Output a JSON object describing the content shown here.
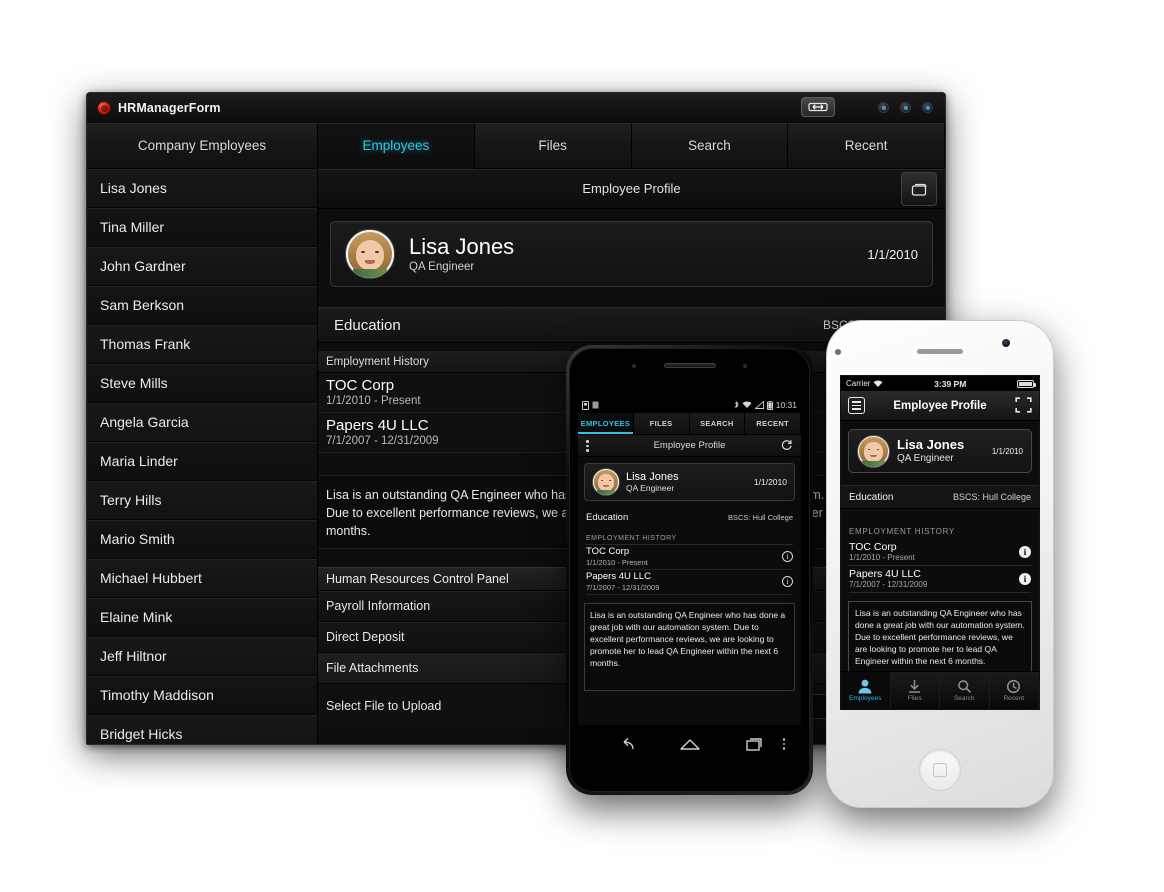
{
  "desktop": {
    "window_title": "HRManagerForm",
    "titlebar": {
      "resize_icon": "resize-arrows-icon",
      "dots": [
        "window-dot-1",
        "window-dot-2",
        "window-dot-3"
      ]
    },
    "tabs": [
      {
        "label": "Company Employees",
        "active": false
      },
      {
        "label": "Employees",
        "active": true
      },
      {
        "label": "Files",
        "active": false
      },
      {
        "label": "Search",
        "active": false
      },
      {
        "label": "Recent",
        "active": false
      }
    ],
    "employees": [
      "Lisa Jones",
      "Tina Miller",
      "John Gardner",
      "Sam Berkson",
      "Thomas Frank",
      "Steve Mills",
      "Angela Garcia",
      "Maria Linder",
      "Terry Hills",
      "Mario Smith",
      "Michael Hubbert",
      "Elaine Mink",
      "Jeff Hiltnor",
      "Timothy Maddison",
      "Bridget Hicks"
    ],
    "main": {
      "header_title": "Employee Profile",
      "expand_icon": "expand-icon",
      "profile": {
        "name": "Lisa Jones",
        "role": "QA Engineer",
        "date": "1/1/2010"
      },
      "education": {
        "label": "Education",
        "value": "BSCS: Hull College"
      },
      "employment_history_label": "Employment History",
      "jobs": [
        {
          "company": "TOC Corp",
          "dates": "1/1/2010 - Present"
        },
        {
          "company": "Papers 4U LLC",
          "dates": "7/1/2007 - 12/31/2009"
        }
      ],
      "notes_line1": "Lisa is an outstanding QA Engineer who has done a great job with our automation system.",
      "notes_line2": "Due to excellent performance reviews, we are looking to promote her to lead QA Engineer within the next 6 months.",
      "hr_panel_title": "Human Resources Control Panel",
      "hr_rows": [
        "Payroll Information",
        "Direct Deposit"
      ],
      "file_attachments_label": "File Attachments",
      "upload_label": "Select File to Upload",
      "upload_value": ""
    }
  },
  "android": {
    "status": {
      "time": "10:31",
      "left_icons": [
        "sim-icon",
        "sd-card-icon"
      ],
      "right_icons": [
        "bluetooth-icon",
        "wifi-icon",
        "signal-icon",
        "battery-icon"
      ]
    },
    "tabs": [
      {
        "label": "EMPLOYEES",
        "active": true
      },
      {
        "label": "FILES",
        "active": false
      },
      {
        "label": "SEARCH",
        "active": false
      },
      {
        "label": "RECENT",
        "active": false
      }
    ],
    "actionbar": {
      "title": "Employee Profile",
      "overflow_icon": "kebab-menu-icon",
      "refresh_icon": "refresh-icon"
    },
    "profile": {
      "name": "Lisa Jones",
      "role": "QA Engineer",
      "date": "1/1/2010"
    },
    "education": {
      "label": "Education",
      "value": "BSCS: Hull College"
    },
    "employment_history_label": "EMPLOYMENT HISTORY",
    "jobs": [
      {
        "company": "TOC Corp",
        "dates": "1/1/2010 - Present",
        "info_icon": "info-icon"
      },
      {
        "company": "Papers 4U LLC",
        "dates": "7/1/2007 - 12/31/2009",
        "info_icon": "info-icon"
      }
    ],
    "notes": "Lisa is an outstanding QA Engineer who has done a great job with our automation system.\nDue to excellent performance reviews, we are looking to promote her to lead QA Engineer within the next 6 months.",
    "nav": [
      "back-icon",
      "home-icon",
      "recents-icon",
      "menu-dots-icon"
    ]
  },
  "iphone": {
    "status": {
      "carrier": "Carrier",
      "time": "3:39 PM",
      "wifi_icon": "wifi-icon",
      "battery_icon": "battery-icon"
    },
    "navbar": {
      "title": "Employee Profile",
      "menu_icon": "list-menu-icon",
      "expand_icon": "expand-icon"
    },
    "profile": {
      "name": "Lisa Jones",
      "role": "QA Engineer",
      "date": "1/1/2010"
    },
    "education": {
      "label": "Education",
      "value": "BSCS: Hull College"
    },
    "employment_history_label": "EMPLOYMENT HISTORY",
    "jobs": [
      {
        "company": "TOC Corp",
        "dates": "1/1/2010 - Present",
        "info_icon": "info-icon"
      },
      {
        "company": "Papers 4U LLC",
        "dates": "7/1/2007 - 12/31/2009",
        "info_icon": "info-icon"
      }
    ],
    "notes": "Lisa is an outstanding QA Engineer who has done a great job with our automation system. Due to excellent performance reviews, we are looking to promote her to lead QA Engineer within the next 6 months.",
    "tabbar": [
      {
        "label": "Employees",
        "icon": "person-icon",
        "active": true
      },
      {
        "label": "Files",
        "icon": "download-icon",
        "active": false
      },
      {
        "label": "Search",
        "icon": "magnifier-icon",
        "active": false
      },
      {
        "label": "Recent",
        "icon": "clock-icon",
        "active": false
      }
    ]
  },
  "colors": {
    "accent": "#31c6e8",
    "ios_accent": "#2fb7e0",
    "window_bg": "#0c0c0c"
  }
}
